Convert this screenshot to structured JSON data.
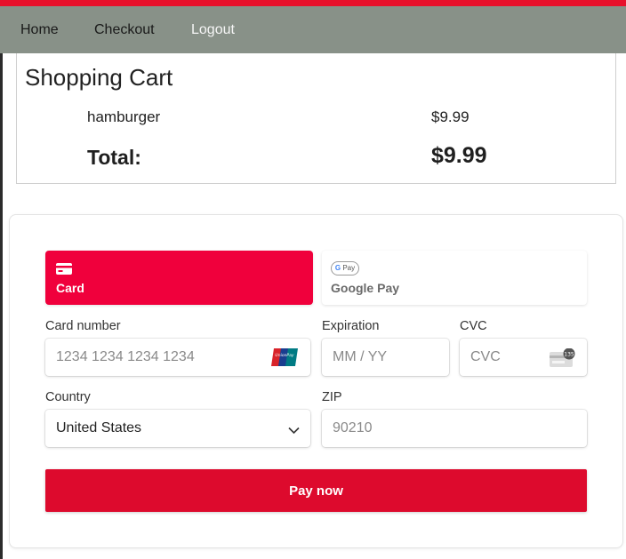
{
  "nav": {
    "home": "Home",
    "checkout": "Checkout",
    "logout": "Logout"
  },
  "cart": {
    "title": "Shopping Cart",
    "items": [
      {
        "name": "hamburger",
        "price": "$9.99"
      }
    ],
    "total_label": "Total:",
    "total_value": "$9.99"
  },
  "payment": {
    "tabs": [
      {
        "label": "Card",
        "icon": "credit-card-icon",
        "selected": true
      },
      {
        "label": "Google Pay",
        "icon": "google-pay-icon",
        "selected": false,
        "badge": "Pay"
      }
    ],
    "card_number": {
      "label": "Card number",
      "placeholder": "1234 1234 1234 1234",
      "brand_icon": "unionpay-icon",
      "brand_text": "UnionPay"
    },
    "expiration": {
      "label": "Expiration",
      "placeholder": "MM / YY"
    },
    "cvc": {
      "label": "CVC",
      "placeholder": "CVC",
      "icon": "cvc-card-icon",
      "icon_text": "135"
    },
    "country": {
      "label": "Country",
      "value": "United States"
    },
    "zip": {
      "label": "ZIP",
      "placeholder": "90210"
    },
    "pay_button": "Pay now"
  },
  "colors": {
    "accent": "#f0003c",
    "pay_button": "#dd0a2d",
    "navbar": "#889188",
    "top_strip": "#e8102b"
  }
}
